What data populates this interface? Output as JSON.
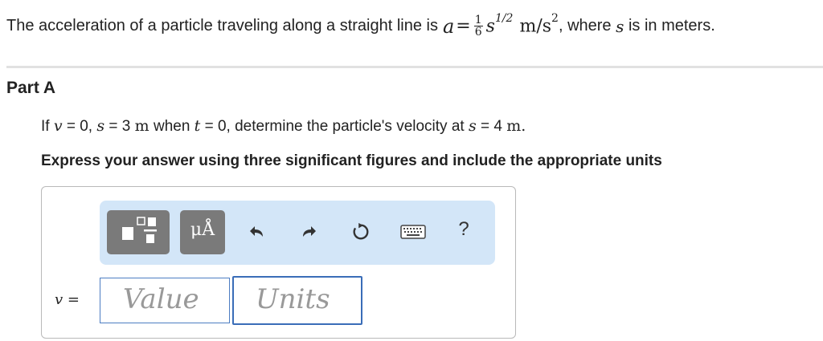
{
  "problem": {
    "intro": "The acceleration of a particle traveling along a straight line is",
    "accel_var": "a",
    "equals": "=",
    "frac_num": "1",
    "frac_den": "6",
    "s_var": "s",
    "exponent": "1/2",
    "units_main": "m/s",
    "units_exp": "2",
    "where_text": ", where",
    "where_var": "s",
    "where_end": "is in meters."
  },
  "part": {
    "title": "Part A"
  },
  "question": {
    "if_text": "If",
    "v_var": "v",
    "eq1": "= 0,",
    "s_var": "s",
    "eq2": "= 3",
    "unit_m": "m",
    "when_text": "when",
    "t_var": "t",
    "eq3": "= 0, determine the particle's velocity at",
    "s_var2": "s",
    "eq4": "= 4",
    "unit_m2": "m."
  },
  "instruction": "Express your answer using three significant figures and include the appropriate units",
  "toolbar": {
    "units_button": "μÅ",
    "help": "?"
  },
  "answer": {
    "var_label": "v =",
    "value_placeholder": "Value",
    "units_placeholder": "Units"
  },
  "colors": {
    "toolbar_bg": "#d3e6f8",
    "button_bg": "#7a7a7a",
    "input_border": "#3a6db8"
  }
}
